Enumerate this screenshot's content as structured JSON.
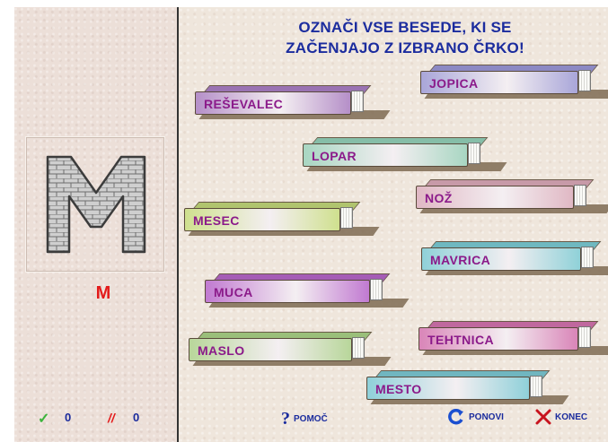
{
  "instruction": {
    "line1": "OZNAČI VSE BESEDE, KI SE",
    "line2": "ZAČENJAJO Z IZBRANO ČRKO!"
  },
  "selected_letter": "M",
  "score": {
    "correct": "0",
    "wrong": "0"
  },
  "books": [
    {
      "word": "REŠEVALEC",
      "color": "#b58fc8",
      "side": "#9a73b3"
    },
    {
      "word": "JOPICA",
      "color": "#a9a6d9",
      "side": "#8c89c4"
    },
    {
      "word": "LOPAR",
      "color": "#a8d6c2",
      "side": "#86bea8"
    },
    {
      "word": "NOŽ",
      "color": "#e0b8c4",
      "side": "#c79aa8"
    },
    {
      "word": "MESEC",
      "color": "#cfe08e",
      "side": "#b0c46e"
    },
    {
      "word": "MAVRICA",
      "color": "#8fd1d8",
      "side": "#6fb8c0"
    },
    {
      "word": "MUCA",
      "color": "#c17ad1",
      "side": "#a55cb6"
    },
    {
      "word": "TEHTNICA",
      "color": "#d985b8",
      "side": "#c0689e"
    },
    {
      "word": "MASLO",
      "color": "#b8d69a",
      "side": "#9abf7a"
    },
    {
      "word": "MESTO",
      "color": "#8fd0d9",
      "side": "#70b6c0"
    }
  ],
  "buttons": {
    "help": "POMOČ",
    "repeat": "PONOVI",
    "end": "KONEC"
  },
  "colors": {
    "title": "#1b2c9e",
    "selected_letter": "#e31b1b",
    "word": "#8b1a8a",
    "check": "#3cb43c",
    "wrong_mark": "#e31b1b",
    "end_x": "#c8141e"
  },
  "icons": {
    "correct": "check-icon",
    "wrong": "double-slash-icon",
    "help": "question-mark-icon",
    "repeat": "circular-arrow-icon",
    "end": "x-icon"
  }
}
